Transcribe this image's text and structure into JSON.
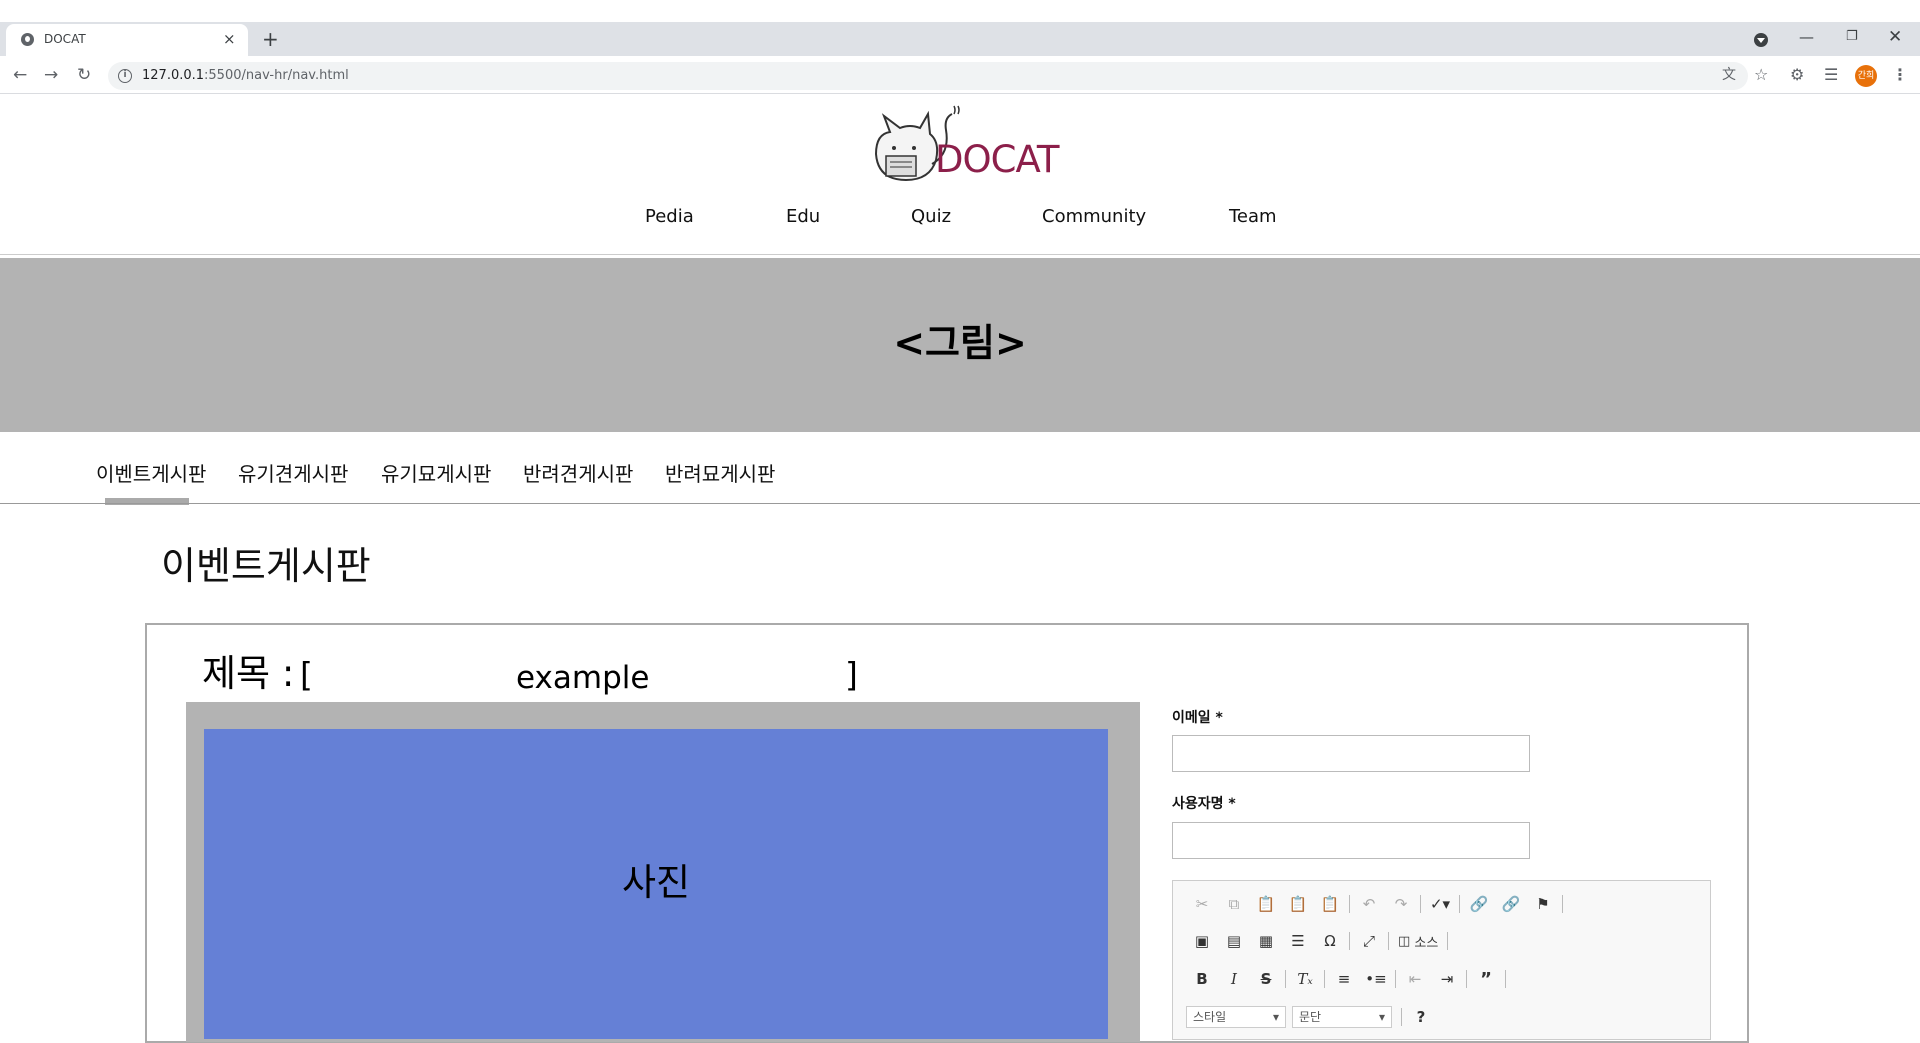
{
  "browser": {
    "tab_title": "DOCAT",
    "tab_close": "×",
    "new_tab": "+",
    "url_host": "127.0.0.1",
    "url_rest": ":5500/nav-hr/nav.html",
    "avatar_text": "간희",
    "icons": [
      "back-arrow-icon",
      "forward-arrow-icon",
      "reload-icon",
      "info-icon",
      "translate-icon",
      "star-icon",
      "extensions-icon",
      "media-icon",
      "menu-icon",
      "minimize-icon",
      "maximize-icon",
      "close-icon"
    ]
  },
  "site": {
    "logo_text": "DOCAT",
    "nav": [
      "Pedia",
      "Edu",
      "Quiz",
      "Community",
      "Team"
    ],
    "banner": "<그림>",
    "subtabs": [
      "이벤트게시판",
      "유기견게시판",
      "유기묘게시판",
      "반려견게시판",
      "반려묘게시판"
    ],
    "page_title": "이벤트게시판"
  },
  "post": {
    "title_label": "제목 :",
    "title_open": "[",
    "title_value": "example",
    "title_close": "]",
    "photo_label": "사진"
  },
  "form": {
    "email_label": "이메일 *",
    "username_label": "사용자명 *"
  },
  "editor": {
    "source_label": "소스",
    "style_combo": "스타일",
    "format_combo": "문단",
    "help": "?"
  },
  "colors": {
    "banner": "#b3b3b3",
    "photo": "#6580d6",
    "logo": "#8c1f4a"
  }
}
